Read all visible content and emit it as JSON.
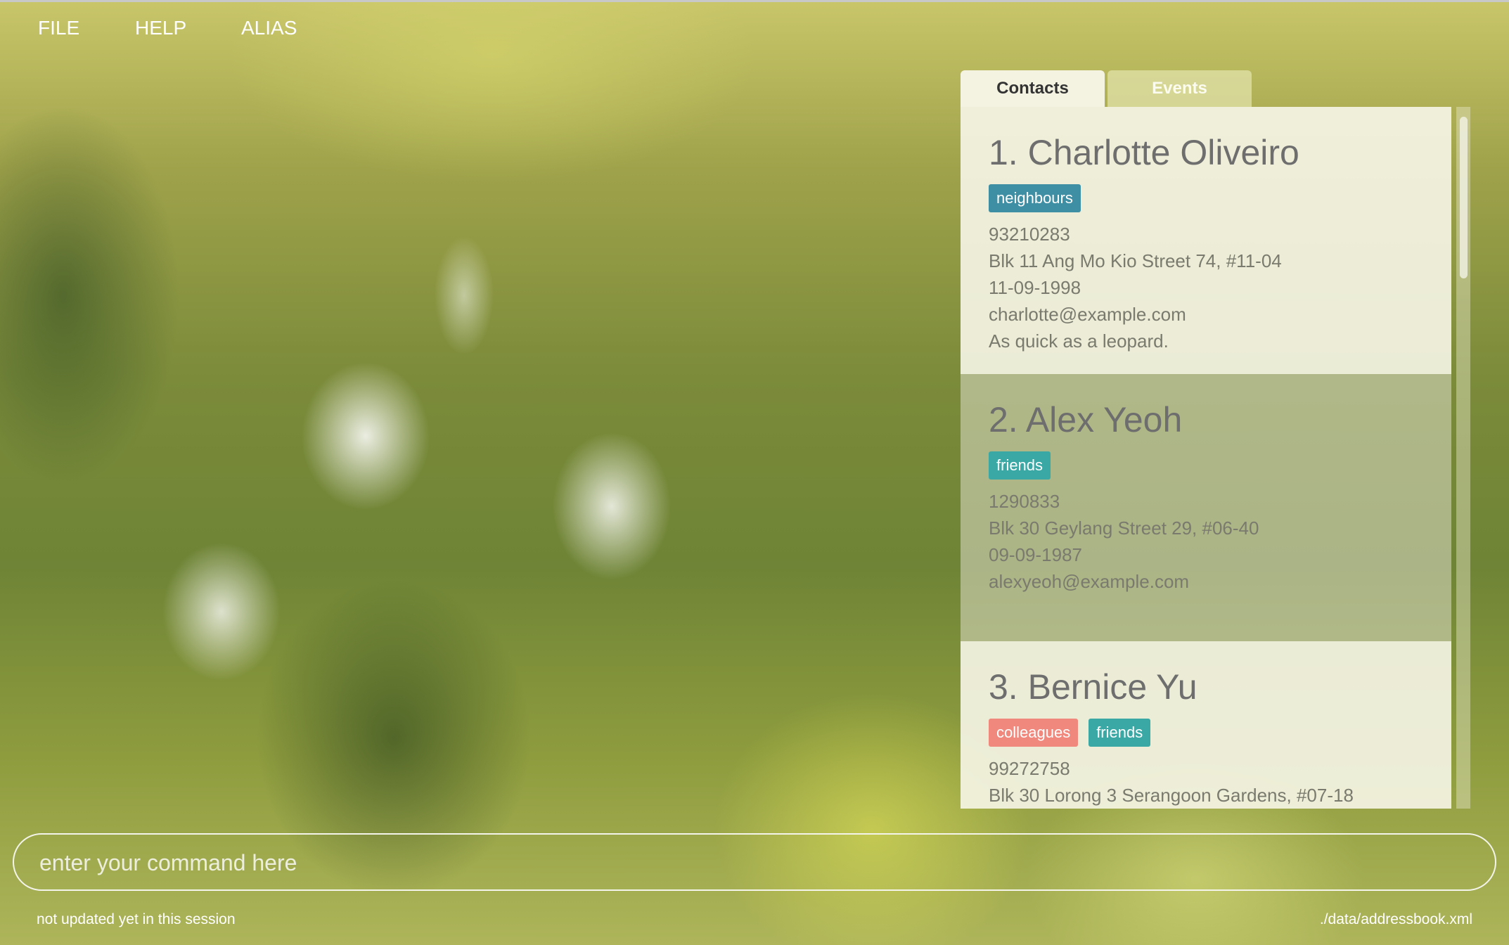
{
  "menu": {
    "file": "FILE",
    "help": "HELP",
    "alias": "ALIAS"
  },
  "tabs": {
    "contacts": "Contacts",
    "events": "Events",
    "active": "Contacts"
  },
  "contacts": [
    {
      "name": "1. Charlotte Oliveiro",
      "tags": [
        "neighbours"
      ],
      "phone": "93210283",
      "address": "Blk 11 Ang Mo Kio Street 74, #11-04",
      "birthday": "11-09-1998",
      "email": "charlotte@example.com",
      "remark": "As quick as a leopard."
    },
    {
      "name": "2. Alex Yeoh",
      "tags": [
        "friends"
      ],
      "phone": "1290833",
      "address": "Blk 30 Geylang Street 29, #06-40",
      "birthday": "09-09-1987",
      "email": "alexyeoh@example.com"
    },
    {
      "name": "3. Bernice Yu",
      "tags": [
        "colleagues",
        "friends"
      ],
      "phone": "99272758",
      "address": "Blk 30 Lorong 3 Serangoon Gardens, #07-18"
    }
  ],
  "command": {
    "placeholder": "enter your command here",
    "value": ""
  },
  "status": {
    "sync": "not updated yet in this session",
    "file_path": "./data/addressbook.xml"
  },
  "colors": {
    "tag_neighbours": "#3f8fa4",
    "tag_friends": "#3aa9a6",
    "tag_colleagues": "#f1887d"
  }
}
